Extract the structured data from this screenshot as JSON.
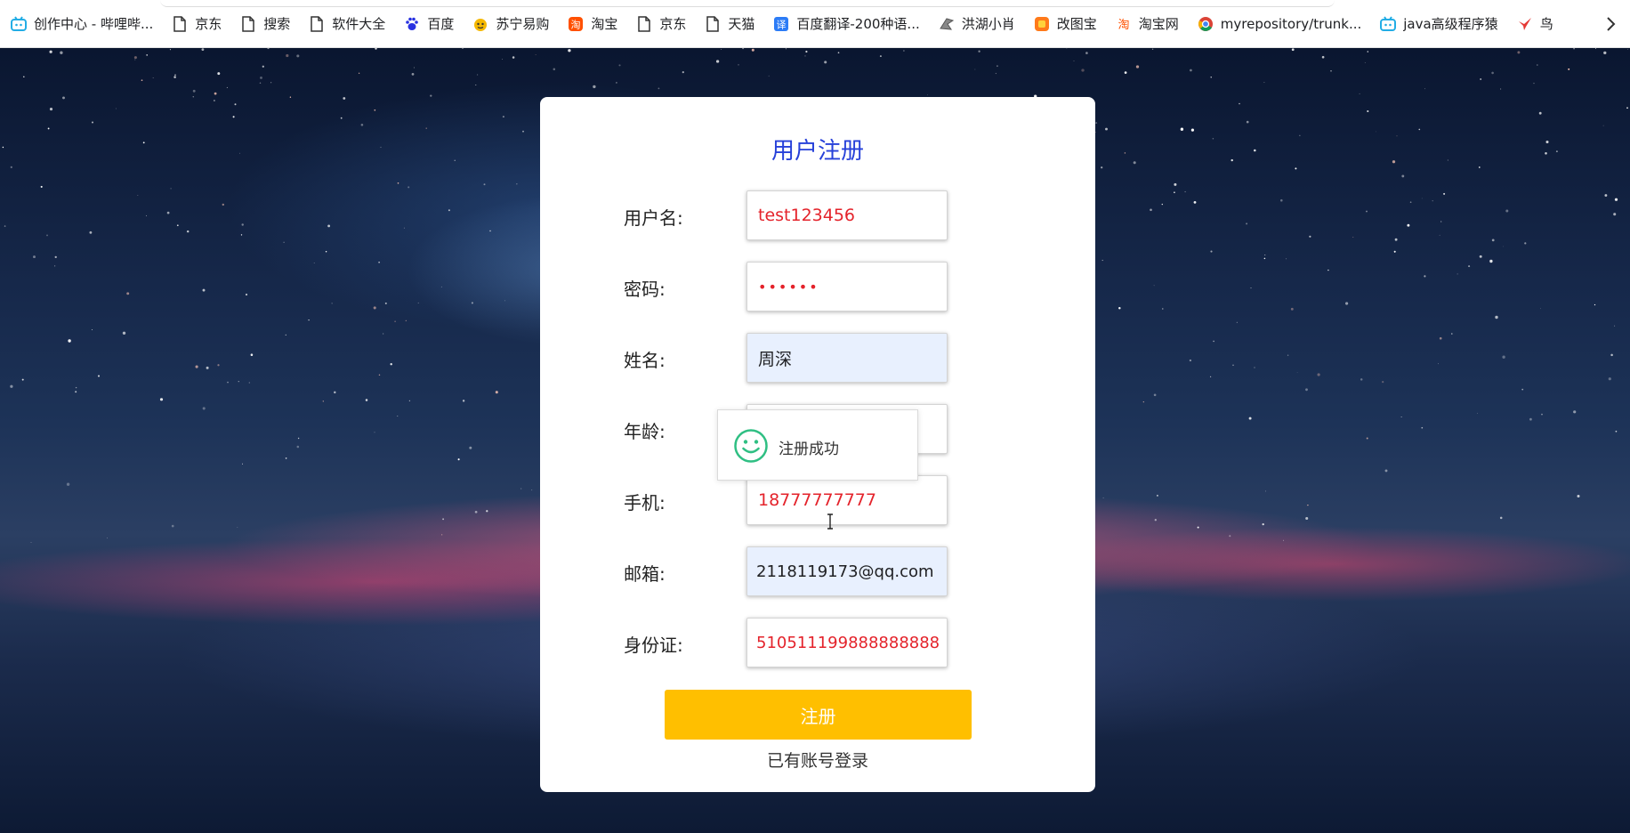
{
  "bookmarks": {
    "items": [
      {
        "label": "创作中心 - 哔哩哔...",
        "icon": "bilibili-icon"
      },
      {
        "label": "京东",
        "icon": "page-icon"
      },
      {
        "label": "搜索",
        "icon": "page-icon"
      },
      {
        "label": "软件大全",
        "icon": "page-icon"
      },
      {
        "label": "百度",
        "icon": "baidu-paw-icon"
      },
      {
        "label": "苏宁易购",
        "icon": "suning-icon"
      },
      {
        "label": "淘宝",
        "icon": "taobao-icon"
      },
      {
        "label": "京东",
        "icon": "page-icon"
      },
      {
        "label": "天猫",
        "icon": "page-icon"
      },
      {
        "label": "百度翻译-200种语...",
        "icon": "translate-icon"
      },
      {
        "label": "洪湖小肖",
        "icon": "bird-icon"
      },
      {
        "label": "改图宝",
        "icon": "gaitubao-icon"
      },
      {
        "label": "淘宝网",
        "icon": "taobao-icon"
      },
      {
        "label": "myrepository/trunk...",
        "icon": "chrome-icon"
      },
      {
        "label": "java高级程序猿",
        "icon": "bilibili-icon"
      },
      {
        "label": "鸟",
        "icon": "bird-red-icon"
      }
    ]
  },
  "form": {
    "title": "用户注册",
    "fields": [
      {
        "label": "用户名:",
        "value": "test123456",
        "autofill": false
      },
      {
        "label": "密码:",
        "value": "••••••",
        "autofill": false
      },
      {
        "label": "姓名:",
        "value": "周深",
        "autofill": true
      },
      {
        "label": "年龄:",
        "value": "",
        "autofill": false
      },
      {
        "label": "手机:",
        "value": "18777777777",
        "autofill": false
      },
      {
        "label": "邮箱:",
        "value": "2118119173@qq.com",
        "autofill": true
      },
      {
        "label": "身份证:",
        "value": "510511199888888888",
        "autofill": false
      }
    ],
    "submit_label": "注册",
    "login_link": "已有账号登录"
  },
  "toast": {
    "message": "注册成功",
    "icon": "smiley-icon"
  },
  "colors": {
    "title": "#2741d9",
    "input_text": "#e4232b",
    "submit_bg": "#ffbf00",
    "autofill_bg": "#e8f0fe",
    "success_icon": "#2fbf83"
  }
}
